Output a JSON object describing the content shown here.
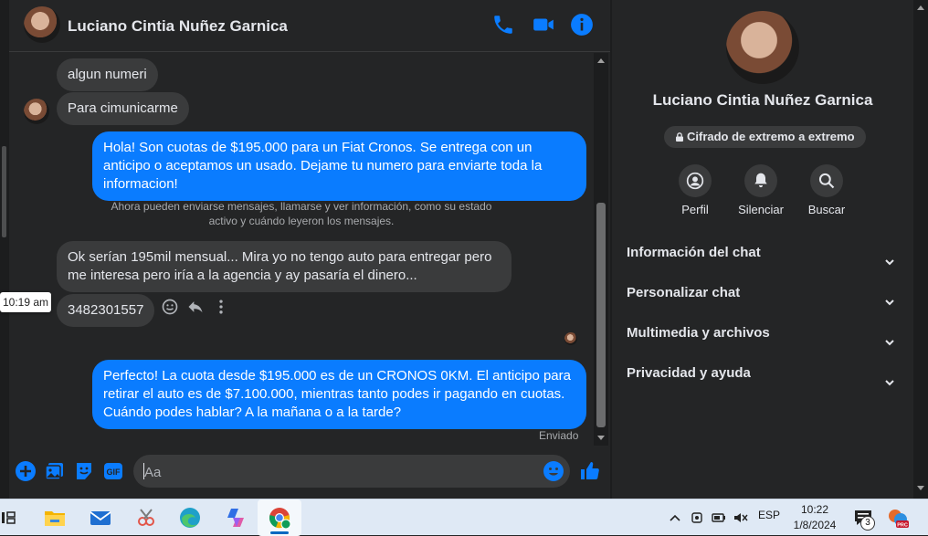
{
  "contact": {
    "name": "Luciano Cintia Nuñez Garnica"
  },
  "header_icons": [
    "phone-icon",
    "video-camera-icon",
    "info-icon"
  ],
  "messages": {
    "m1": "algun numeri",
    "m2": "Para cimunicarme",
    "m3": "Hola! Son cuotas de $195.000 para un Fiat Cronos. Se entrega con un anticipo o aceptamos un usado. Dejame tu numero para enviarte toda la informacion!",
    "system": "Ahora pueden enviarse mensajes, llamarse y ver información, como su estado activo y cuándo leyeron los mensajes.",
    "m4": "Ok serían 195mil mensual... Mira yo no tengo auto para entregar pero me interesa pero iría a la agencia y ay pasaría el dinero...",
    "m5": "3482301557",
    "m5_time": "10:19 am",
    "m6": "Perfecto! La cuota desde $195.000 es de un CRONOS 0KM. El anticipo para retirar el auto es de $7.100.000, mientras tanto podes ir pagando en cuotas. Cuándo podes hablar? A la mañana o a la tarde?",
    "status": "Enviado"
  },
  "composer": {
    "placeholder": "Aa",
    "gif_label": "GIF"
  },
  "info_panel": {
    "name": "Luciano Cintia Nuñez Garnica",
    "encryption": "Cifrado de extremo a extremo",
    "actions": [
      {
        "label": "Perfil",
        "icon": "profile-icon"
      },
      {
        "label": "Silenciar",
        "icon": "bell-icon"
      },
      {
        "label": "Buscar",
        "icon": "search-icon"
      }
    ],
    "sections": [
      {
        "label": "Información del chat"
      },
      {
        "label": "Personalizar chat"
      },
      {
        "label": "Multimedia y archivos"
      },
      {
        "label": "Privacidad y ayuda"
      }
    ]
  },
  "taskbar": {
    "language": "ESP",
    "time": "10:22",
    "date": "1/8/2024",
    "notifications": "3"
  },
  "colors": {
    "accent": "#0a7cff",
    "background": "#242526",
    "incoming_bubble": "#3a3b3c",
    "taskbar": "#dfe9f5"
  }
}
